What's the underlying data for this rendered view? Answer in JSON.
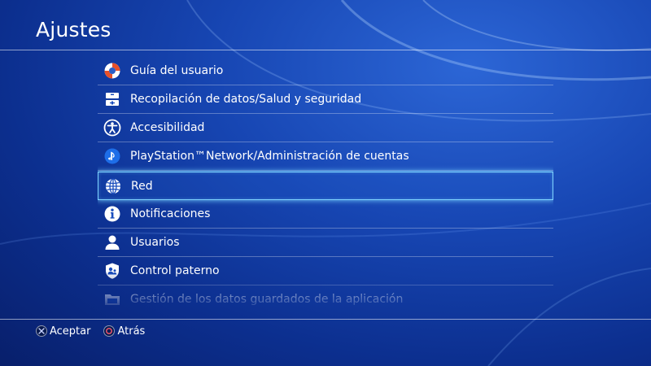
{
  "header": {
    "title": "Ajustes"
  },
  "menu": {
    "items": [
      {
        "label": "Guía del usuario",
        "icon": "lifebuoy-icon"
      },
      {
        "label": "Recopilación de datos/Salud y seguridad",
        "icon": "data-health-icon"
      },
      {
        "label": "Accesibilidad",
        "icon": "accessibility-icon"
      },
      {
        "label": "PlayStation™Network/Administración de cuentas",
        "icon": "playstation-icon"
      },
      {
        "label": "Red",
        "icon": "globe-icon",
        "selected": true
      },
      {
        "label": "Notificaciones",
        "icon": "info-icon"
      },
      {
        "label": "Usuarios",
        "icon": "user-icon"
      },
      {
        "label": "Control paterno",
        "icon": "parental-control-icon"
      },
      {
        "label": "Gestión de los datos guardados de la aplicación",
        "icon": "folder-icon"
      }
    ]
  },
  "footer": {
    "accept_label": "Aceptar",
    "back_label": "Atrás"
  },
  "colors": {
    "background": "#1746b3",
    "selection_outline": "#7fd4ff"
  }
}
